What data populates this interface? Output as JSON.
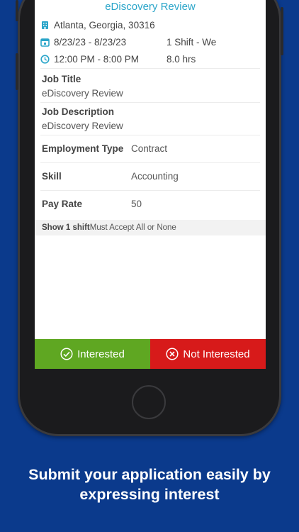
{
  "job": {
    "title_header": "eDiscovery Review",
    "location": "Atlanta, Georgia, 30316",
    "dates": "8/23/23 - 8/23/23",
    "shift_count": "1 Shift - We",
    "time_range": "12:00 PM - 8:00 PM",
    "hours": "8.0 hrs",
    "job_title_label": "Job Title",
    "job_title_value": "eDiscovery Review",
    "job_desc_label": "Job Description",
    "job_desc_value": "eDiscovery Review",
    "employment_type_label": "Employment Type",
    "employment_type_value": "Contract",
    "skill_label": "Skill",
    "skill_value": "Accounting",
    "pay_rate_label": "Pay Rate",
    "pay_rate_value": "50",
    "show_shift": "Show 1 shift",
    "shift_rule": "Must Accept All or None"
  },
  "actions": {
    "interested": "Interested",
    "not_interested": "Not Interested"
  },
  "caption": {
    "line1": "Submit your application easily by",
    "line2": "expressing interest"
  },
  "colors": {
    "background": "#0b3a8c",
    "accent": "#2aa5c9",
    "interested": "#5fa722",
    "not_interested": "#d71a1a"
  }
}
